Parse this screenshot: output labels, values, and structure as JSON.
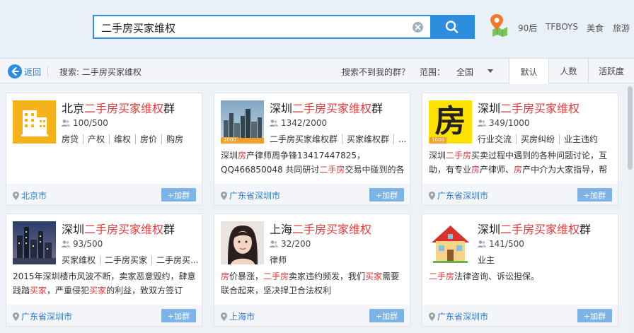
{
  "search": {
    "query": "二手房买家维权"
  },
  "hot_links": [
    "90后",
    "TFBOYS",
    "美食",
    "旅游"
  ],
  "filter": {
    "back_label": "返回",
    "search_label": "搜索: 二手房买家维权",
    "not_found": "搜索不到我的群？",
    "range_label": "范围：",
    "range_value": "全国",
    "sort_tabs": [
      "默认",
      "人数",
      "活跃度"
    ]
  },
  "join_label": "+加群",
  "groups": [
    {
      "title_prefix": "北京",
      "title_highlight": "二手房买家维权",
      "title_suffix": "群",
      "count": "100/500",
      "tags": [
        "房贷",
        "产权",
        "维权",
        "房价",
        "购房"
      ],
      "desc": [],
      "location": "北京市"
    },
    {
      "title_prefix": "深圳",
      "title_highlight": "二手房买家维权",
      "title_suffix": "群",
      "count": "1342/2000",
      "tags": [
        "二手房买家维权群",
        "买家维权群",
        "..."
      ],
      "desc": [
        {
          "t": "深圳",
          "h": false
        },
        {
          "t": "房",
          "h": true
        },
        {
          "t": "产律师周争锋13417447825，QQ466850048 共同研讨",
          "h": false
        },
        {
          "t": "二手房",
          "h": true
        },
        {
          "t": "交易中碰到的各种问题。",
          "h": false
        }
      ],
      "location": "广东省深圳市"
    },
    {
      "title_prefix": "深圳",
      "title_highlight": "二手房买家维权",
      "title_suffix": "",
      "count": "349/1000",
      "tags": [
        "行业交流",
        "买房纠纷",
        "业主违约"
      ],
      "desc": [
        {
          "t": "深圳",
          "h": false
        },
        {
          "t": "二手房",
          "h": true
        },
        {
          "t": "买卖过程中遇到的各种问题讨论，互助，有专业",
          "h": false
        },
        {
          "t": "房",
          "h": true
        },
        {
          "t": "产律师、",
          "h": false
        },
        {
          "t": "房",
          "h": true
        },
        {
          "t": "产中介为大家指导，帮助...",
          "h": false
        }
      ],
      "location": "广东省深圳市"
    },
    {
      "title_prefix": "深圳",
      "title_highlight": "二手房买家维权",
      "title_suffix": "群",
      "count": "93/500",
      "tags": [
        "买家维权",
        "二手房买家",
        "二手房买..."
      ],
      "desc": [
        {
          "t": "2015年深圳楼市风波不断，卖家恶意毁约，肆意践踏",
          "h": false
        },
        {
          "t": "买家",
          "h": true
        },
        {
          "t": "，严重侵犯",
          "h": false
        },
        {
          "t": "买家",
          "h": true
        },
        {
          "t": "的利益，致双方签订合...",
          "h": false
        }
      ],
      "location": "广东省深圳市"
    },
    {
      "title_prefix": "上海",
      "title_highlight": "二手房买家维权",
      "title_suffix": "",
      "count": "32/200",
      "tags": [
        "律师"
      ],
      "desc": [
        {
          "t": "房",
          "h": true
        },
        {
          "t": "价暴涨，",
          "h": false
        },
        {
          "t": "二手房",
          "h": true
        },
        {
          "t": "卖家违约频发，我们",
          "h": false
        },
        {
          "t": "买家",
          "h": true
        },
        {
          "t": "需要联合起来，坚决捍卫合法权利",
          "h": false
        }
      ],
      "location": "上海市"
    },
    {
      "title_prefix": "深圳",
      "title_highlight": "二手房买家维权",
      "title_suffix": "群",
      "count": "141/500",
      "tags": [
        "业主"
      ],
      "desc": [
        {
          "t": "二手房",
          "h": true
        },
        {
          "t": "法律咨询、诉讼担保。",
          "h": false
        }
      ],
      "location": "广东省深圳市"
    }
  ],
  "avatar_text": {
    "fang": "房",
    "badge_2000": "2000",
    "badge_1000": "1000"
  },
  "colors": {
    "accent": "#2d8ee0",
    "highlight": "#e23a3a",
    "join": "#7eb3e6"
  }
}
